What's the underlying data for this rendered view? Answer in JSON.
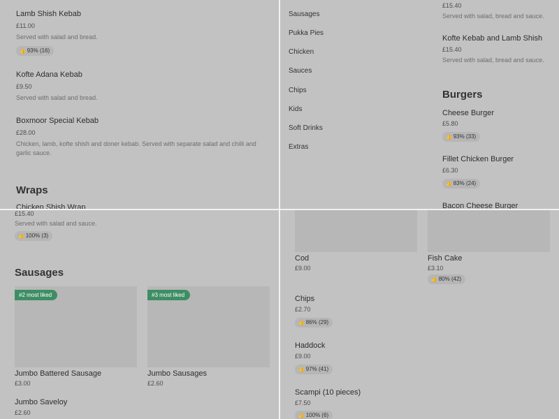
{
  "top_left": {
    "items": [
      {
        "name": "Lamb Shish Kebab",
        "price": "£11.00",
        "desc": "Served with salad and bread.",
        "rating": "93% (16)"
      },
      {
        "name": "Kofte Adana Kebab",
        "price": "£9.50",
        "desc": "Served with salad and bread."
      },
      {
        "name": "Boxmoor Special Kebab",
        "price": "£28.00",
        "desc": "Chicken, lamb, kofte shish and doner kebab. Served with separate salad and chilli and garlic sauce."
      }
    ],
    "wraps_heading": "Wraps",
    "partial_item": "Chicken Shish Wrap"
  },
  "top_right": {
    "categories": [
      "Sausages",
      "Pukka Pies",
      "Chicken",
      "Sauces",
      "Chips",
      "Kids",
      "Soft Drinks",
      "Extras"
    ],
    "partial_price": "£15.40",
    "partial_desc": "Served with salad, bread and sauce.",
    "item": {
      "name": "Kofte Kebab and Lamb Shish",
      "price": "£15.40",
      "desc": "Served with salad, bread and sauce."
    },
    "burgers_heading": "Burgers",
    "burgers": [
      {
        "name": "Cheese Burger",
        "price": "£5.80",
        "rating": "93% (33)"
      },
      {
        "name": "Fillet Chicken Burger",
        "price": "£6.30",
        "rating": "83% (24)"
      },
      {
        "name": "Bacon Cheese Burger"
      }
    ]
  },
  "bottom_left": {
    "partial_price": "£15.40",
    "partial_desc": "Served with salad and sauce.",
    "partial_rating": "100% (3)",
    "sausages_heading": "Sausages",
    "cards": [
      {
        "name": "Jumbo Battered Sausage",
        "price": "£3.00",
        "tag": "#2 most liked"
      },
      {
        "name": "Jumbo Sausages",
        "price": "£2.60",
        "tag": "#3 most liked"
      }
    ],
    "item": {
      "name": "Jumbo Saveloy",
      "price": "£2.60"
    }
  },
  "bottom_right": {
    "cards": [
      {
        "name": "Cod",
        "price": "£9.00"
      },
      {
        "name": "Fish Cake",
        "price": "£3.10",
        "rating": "80% (42)"
      }
    ],
    "items": [
      {
        "name": "Chips",
        "price": "£2.70",
        "rating": "86% (29)"
      },
      {
        "name": "Haddock",
        "price": "£9.00",
        "rating": "97% (41)"
      },
      {
        "name": "Scampi (10 pieces)",
        "price": "£7.50",
        "rating": "100% (6)"
      }
    ]
  },
  "icons": {
    "thumb": "thumbs-up-icon"
  }
}
